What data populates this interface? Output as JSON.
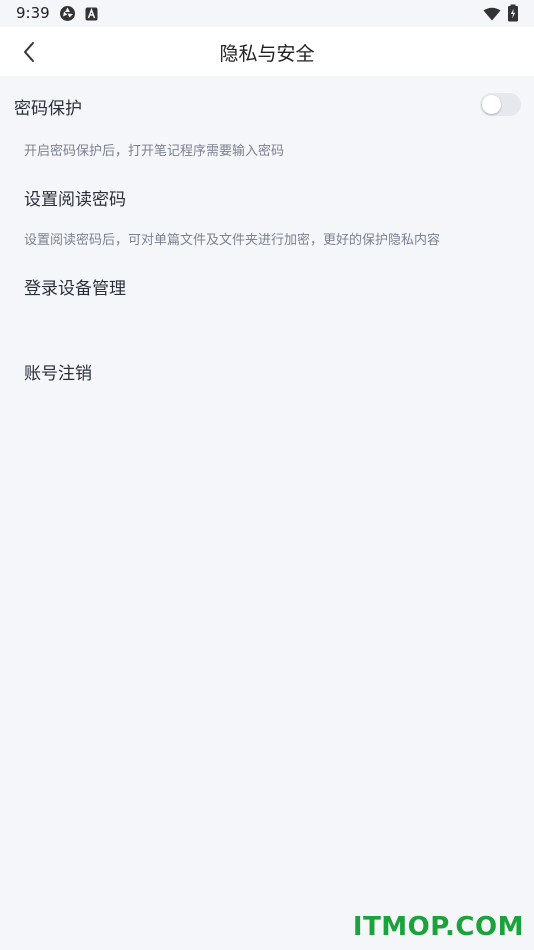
{
  "status_bar": {
    "time": "9:39",
    "left_icons": [
      "aperture-icon",
      "a-badge-icon"
    ],
    "right_icons": [
      "wifi-icon",
      "battery-icon"
    ]
  },
  "header": {
    "title": "隐私与安全",
    "back_icon": "chevron-left-icon"
  },
  "settings": {
    "password_protection": {
      "title": "密码保护",
      "description": "开启密码保护后，打开笔记程序需要输入密码",
      "enabled": false
    },
    "reading_password": {
      "title": "设置阅读密码",
      "description": "设置阅读密码后，可对单篇文件及文件夹进行加密，更好的保护隐私内容"
    },
    "device_management": {
      "title": "登录设备管理"
    },
    "account_cancel": {
      "title": "账号注销"
    }
  },
  "watermark": "ITMOP.COM",
  "colors": {
    "background": "#f5f6fa",
    "header_bg": "#ffffff",
    "text_primary": "#2b2f3a",
    "text_secondary": "#7d8190",
    "toggle_off": "#e6e8ee",
    "watermark": "#1aa33a"
  }
}
